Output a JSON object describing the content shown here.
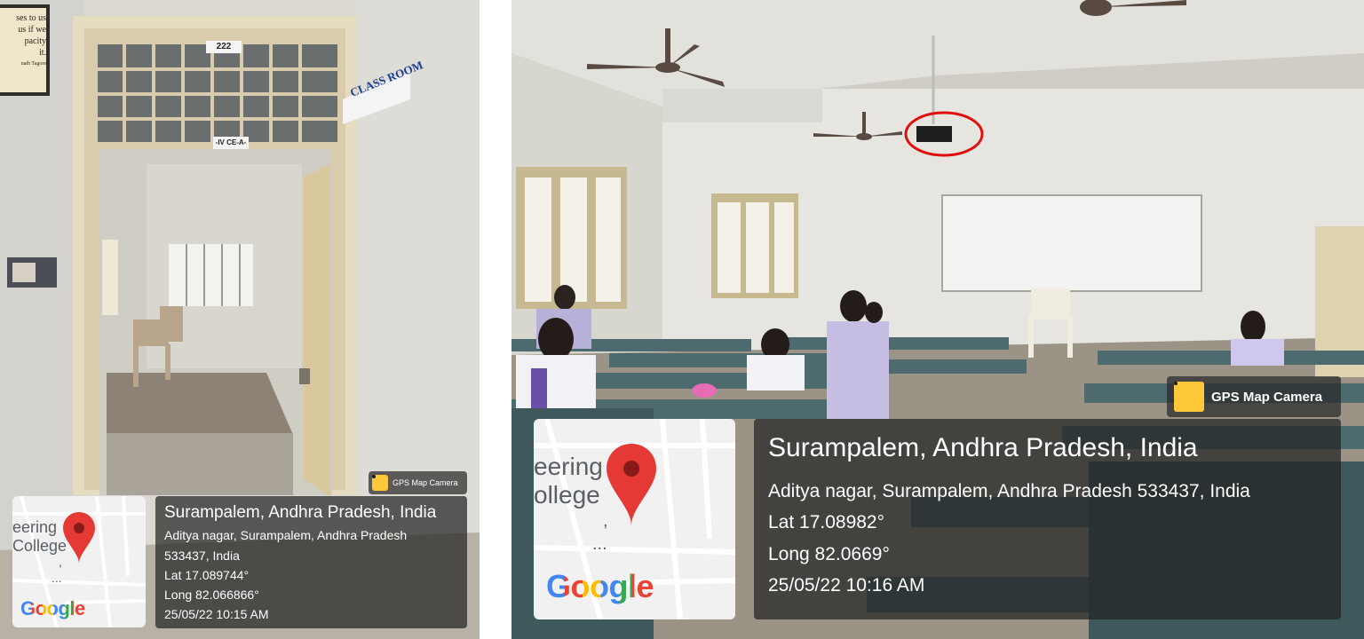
{
  "left": {
    "room_number": "222",
    "room_class": "-IV CE-A-",
    "class_room_sign": "CLASS ROOM",
    "quote_lines": [
      "ses to us",
      "us if we",
      "pacity",
      "it.",
      "nath Tagore"
    ],
    "gps_brand": "GPS Map Camera",
    "map_text": [
      "eering",
      "College",
      ",",
      "..."
    ],
    "google_logo": "Google",
    "location_title": "Surampalem, Andhra Pradesh, India",
    "address_line1": "Aditya nagar, Surampalem, Andhra Pradesh",
    "address_line2": "533437, India",
    "lat": "Lat 17.089744°",
    "long": "Long 82.066866°",
    "datetime": "25/05/22 10:15 AM"
  },
  "right": {
    "gps_brand": "GPS Map Camera",
    "map_text": [
      "eering",
      "ollege",
      ",",
      "..."
    ],
    "google_logo": "Google",
    "location_title": "Surampalem, Andhra Pradesh, India",
    "address": "Aditya nagar, Surampalem, Andhra Pradesh 533437, India",
    "lat": "Lat 17.08982°",
    "long": "Long 82.0669°",
    "datetime": "25/05/22 10:16 AM"
  },
  "colors": {
    "google_blue": "#4285F4",
    "google_red": "#EA4335",
    "google_yellow": "#FBBC05",
    "google_green": "#34A853",
    "pin_red": "#E53935",
    "highlight_circle": "#E10E0E"
  }
}
